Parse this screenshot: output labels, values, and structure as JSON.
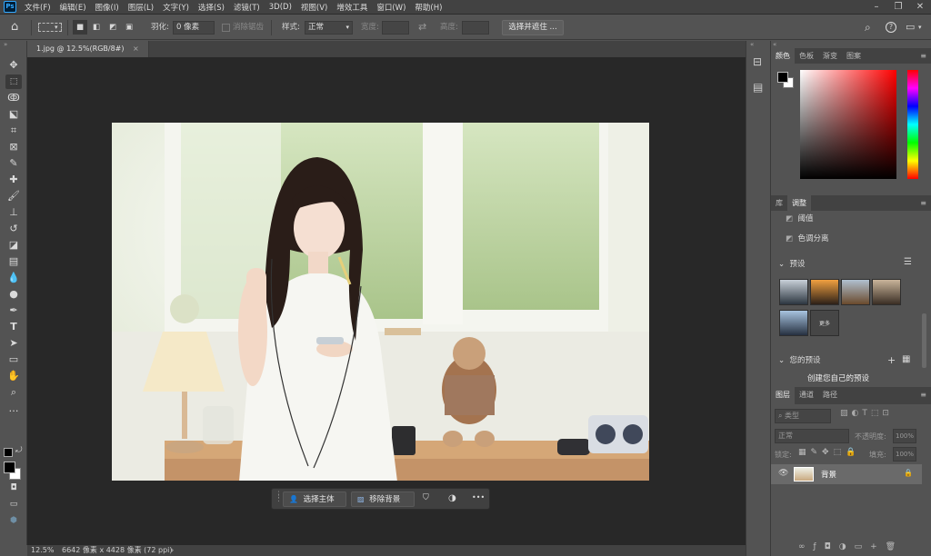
{
  "menubar": {
    "logo": "Ps",
    "items": [
      "文件(F)",
      "编辑(E)",
      "图像(I)",
      "图层(L)",
      "文字(Y)",
      "选择(S)",
      "滤镜(T)",
      "3D(D)",
      "视图(V)",
      "增效工具",
      "窗口(W)",
      "帮助(H)"
    ]
  },
  "options": {
    "feather_label": "羽化:",
    "feather_value": "0 像素",
    "antialias_label": "消除锯齿",
    "style_label": "样式:",
    "style_value": "正常",
    "width_label": "宽度:",
    "height_label": "高度:",
    "select_mask_button": "选择并遮住 ..."
  },
  "document": {
    "tab_title": "1.jpg @ 12.5%(RGB/8#)",
    "close": "×"
  },
  "context_bar": {
    "select_subject": "选择主体",
    "remove_background": "移除背景",
    "more": "•••"
  },
  "status": {
    "zoom": "12.5%",
    "info": "6642 像素 x 4428 像素 (72 ppi)",
    "arrow": "›"
  },
  "color_panel": {
    "tabs": [
      "颜色",
      "色板",
      "渐变",
      "图案"
    ],
    "active_tab": "颜色",
    "field_hue_color": "#ff0000"
  },
  "adjust_panel": {
    "tabs": [
      "库",
      "调整"
    ],
    "active_tab": "调整",
    "items": [
      "阈值",
      "色调分离"
    ],
    "presets_label": "预设",
    "more_label": "更多",
    "your_presets_label": "您的预设",
    "create_label": "创建您自己的预设"
  },
  "layers_panel": {
    "tabs": [
      "图层",
      "通道",
      "路径"
    ],
    "active_tab": "图层",
    "search_placeholder": "类型",
    "blend_mode": "正常",
    "opacity_label": "不透明度:",
    "opacity_value": "100%",
    "lock_label": "锁定:",
    "fill_label": "填充:",
    "fill_value": "100%",
    "layer_name": "背景"
  }
}
